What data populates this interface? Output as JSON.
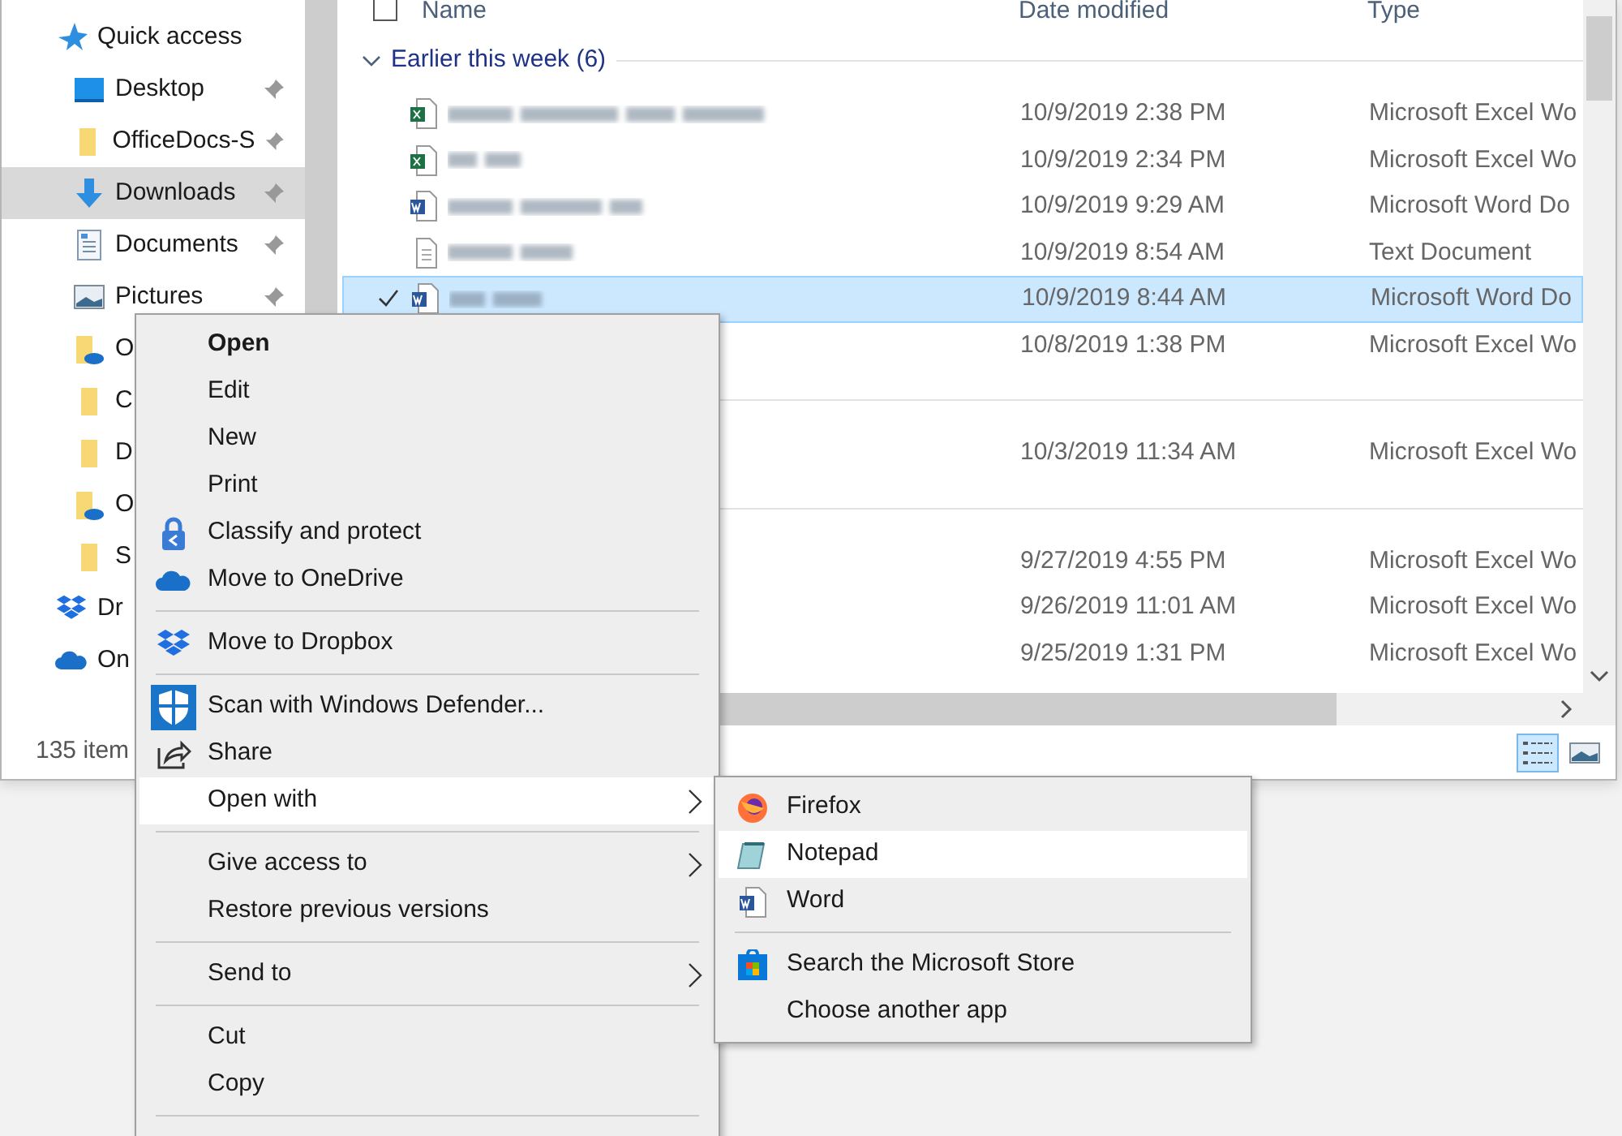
{
  "sidebar": {
    "items": [
      {
        "kind": "star",
        "label": "Quick access",
        "selected": false,
        "children": [
          {
            "kind": "desktop",
            "label": "Desktop",
            "pinned": true,
            "selected": false
          },
          {
            "kind": "folder",
            "label": "OfficeDocs-S",
            "pinned": true,
            "selected": false
          },
          {
            "kind": "download",
            "label": "Downloads",
            "pinned": true,
            "selected": true
          },
          {
            "kind": "documents",
            "label": "Documents",
            "pinned": true,
            "selected": false
          },
          {
            "kind": "pictures",
            "label": "Pictures",
            "pinned": true,
            "selected": false
          },
          {
            "kind": "cloud-folder",
            "label": "O",
            "pinned": false,
            "selected": false
          },
          {
            "kind": "folder",
            "label": "C",
            "pinned": false,
            "selected": false
          },
          {
            "kind": "folder",
            "label": "D",
            "pinned": false,
            "selected": false
          },
          {
            "kind": "cloud-folder",
            "label": "O",
            "pinned": false,
            "selected": false
          },
          {
            "kind": "folder",
            "label": "S",
            "pinned": false,
            "selected": false
          }
        ]
      },
      {
        "kind": "dropbox",
        "label": "Dr",
        "selected": false
      },
      {
        "kind": "cloud",
        "label": "On",
        "selected": false
      }
    ]
  },
  "file_list": {
    "select_all_checked": false,
    "columns": [
      "Name",
      "Date modified",
      "Type"
    ],
    "groups": [
      {
        "label": "Earlier this week (6)",
        "expanded": true,
        "rows": [
          {
            "kind": "excel",
            "date": "10/9/2019 2:38 PM",
            "type": "Microsoft Excel Wo",
            "selected": false
          },
          {
            "kind": "excel",
            "date": "10/9/2019 2:34 PM",
            "type": "Microsoft Excel Wo",
            "selected": false
          },
          {
            "kind": "word",
            "date": "10/9/2019 9:29 AM",
            "type": "Microsoft Word Do",
            "selected": false
          },
          {
            "kind": "text",
            "date": "10/9/2019 8:54 AM",
            "type": "Text Document",
            "selected": false
          },
          {
            "kind": "word",
            "date": "10/9/2019 8:44 AM",
            "type": "Microsoft Word Do",
            "selected": true
          },
          {
            "date": "10/8/2019 1:38 PM",
            "type": "Microsoft Excel Wo",
            "selected": false
          }
        ]
      },
      {
        "rows": [
          {
            "date": "10/3/2019 11:34 AM",
            "type": "Microsoft Excel Wo",
            "selected": false
          }
        ]
      },
      {
        "rows": [
          {
            "date": "9/27/2019 4:55 PM",
            "type": "Microsoft Excel Wo",
            "selected": false
          },
          {
            "date": "9/26/2019 11:01 AM",
            "type": "Microsoft Excel Wo",
            "selected": false
          },
          {
            "date": "9/25/2019 1:31 PM",
            "type": "Microsoft Excel Wo",
            "selected": false
          }
        ]
      }
    ]
  },
  "status_bar": {
    "item_count": "135 item",
    "views": [
      {
        "kind": "details",
        "selected": true
      },
      {
        "kind": "large",
        "selected": false
      }
    ]
  },
  "context_menu": {
    "items": [
      {
        "kind": "plain",
        "label": "Open",
        "bold": true,
        "highlighted": false
      },
      {
        "kind": "plain",
        "label": "Edit",
        "highlighted": false
      },
      {
        "kind": "plain",
        "label": "New",
        "highlighted": false
      },
      {
        "kind": "plain",
        "label": "Print",
        "highlighted": false
      },
      {
        "kind": "lock",
        "label": "Classify and protect",
        "highlighted": false
      },
      {
        "kind": "cloud",
        "label": "Move to OneDrive",
        "highlighted": false
      },
      {
        "kind": "separator"
      },
      {
        "kind": "dropbox",
        "label": "Move to Dropbox",
        "highlighted": false
      },
      {
        "kind": "separator"
      },
      {
        "kind": "shield",
        "label": "Scan with Windows Defender...",
        "highlighted": false
      },
      {
        "kind": "share",
        "label": "Share",
        "highlighted": false
      },
      {
        "kind": "plain",
        "label": "Open with",
        "has_submenu": true,
        "highlighted": true
      },
      {
        "kind": "separator"
      },
      {
        "kind": "plain",
        "label": "Give access to",
        "has_submenu": true,
        "highlighted": false
      },
      {
        "kind": "plain",
        "label": "Restore previous versions",
        "highlighted": false
      },
      {
        "kind": "separator"
      },
      {
        "kind": "plain",
        "label": "Send to",
        "has_submenu": true,
        "highlighted": false
      },
      {
        "kind": "separator"
      },
      {
        "kind": "plain",
        "label": "Cut",
        "highlighted": false
      },
      {
        "kind": "plain",
        "label": "Copy",
        "highlighted": false
      },
      {
        "kind": "separator"
      }
    ]
  },
  "submenu": {
    "items": [
      {
        "kind": "firefox",
        "label": "Firefox",
        "highlighted": false
      },
      {
        "kind": "notepad",
        "label": "Notepad",
        "highlighted": true
      },
      {
        "kind": "word",
        "label": "Word",
        "highlighted": false
      },
      {
        "kind": "separator"
      },
      {
        "kind": "store",
        "label": "Search the Microsoft Store",
        "highlighted": false
      },
      {
        "kind": "plain",
        "label": "Choose another app",
        "highlighted": false
      }
    ]
  }
}
